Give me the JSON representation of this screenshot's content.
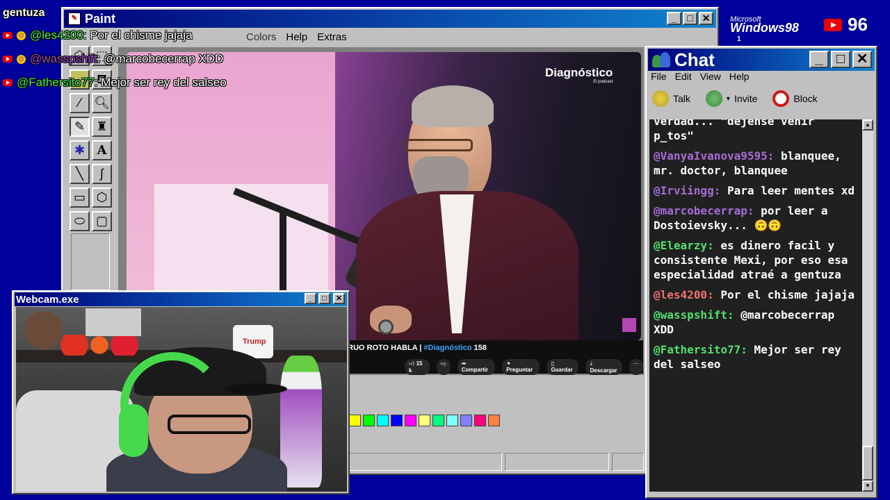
{
  "overlay": {
    "top_user": "gentuza",
    "lines": [
      {
        "user": "@les4200",
        "text": ": Por el chisme jajaja",
        "color": "#44ee55"
      },
      {
        "user": "@wasspshift",
        "text": ": @marcobecerrap XDD",
        "color": "#9a4ecf"
      },
      {
        "user": "@Fathersito77",
        "text": ": Mejor ser rey del salseo",
        "color": "#44ee55"
      }
    ]
  },
  "subscriber_count": "96",
  "os_logo": {
    "small": "Microsoft",
    "big": "Windows98",
    "num": "1"
  },
  "paint": {
    "title": "Paint",
    "menu": [
      "File",
      "Edit",
      "View",
      "Image",
      "Colors",
      "Help",
      "Extras"
    ],
    "tools": [
      "free-select",
      "select",
      "eraser",
      "fill",
      "picker",
      "magnifier",
      "pencil",
      "brush",
      "airbrush",
      "text",
      "line",
      "curve",
      "rectangle",
      "polygon",
      "ellipse",
      "rounded-rect"
    ],
    "palette": [
      "#ffff00",
      "#00ff00",
      "#00ffff",
      "#0000ff",
      "#ff00ff",
      "#ffff80",
      "#00ff80",
      "#80ffff",
      "#8080ff",
      "#ff0080",
      "#ff8040"
    ]
  },
  "video": {
    "brand": "Diagnóstico",
    "brand_sub": "El podcast",
    "title": "RUO ROTO HABLA | ",
    "hashtag": "#Diagnóstico",
    "title_suffix": " 158",
    "likes": "15 k",
    "share": "Compartir",
    "ask": "Preguntar",
    "save": "Guardar",
    "download": "Descargar"
  },
  "webcam": {
    "title": "Webcam.exe",
    "sign": "Trump"
  },
  "chat": {
    "title": "Chat",
    "menu": [
      "File",
      "Edit",
      "View",
      "Help"
    ],
    "actions": [
      "Talk",
      "Invite",
      "Block"
    ],
    "messages": [
      {
        "user": "",
        "text": "verdad... \"dejense venir p_tos\"",
        "color": "#ffffff"
      },
      {
        "user": "@VanyaIvanova9595:",
        "text": " blanquee, mr. doctor, blanquee",
        "color": "#a86cd8"
      },
      {
        "user": "@Irviingg:",
        "text": " Para leer mentes xd",
        "color": "#a86cd8"
      },
      {
        "user": "@marcobecerrap:",
        "text": " por leer a Dostoievsky... 🙃🙃",
        "color": "#a86cd8"
      },
      {
        "user": "@Elearzy:",
        "text": " es dinero facil y consistente Mexi, por eso esa especialidad atraé a gentuza",
        "color": "#52e070"
      },
      {
        "user": "@les4200:",
        "text": " Por el chisme jajaja",
        "color": "#f07070"
      },
      {
        "user": "@wasspshift:",
        "text": " @marcobecerrap XDD",
        "color": "#52e070"
      },
      {
        "user": "@Fathersito77:",
        "text": " Mejor ser rey del salseo",
        "color": "#52e070"
      }
    ]
  }
}
